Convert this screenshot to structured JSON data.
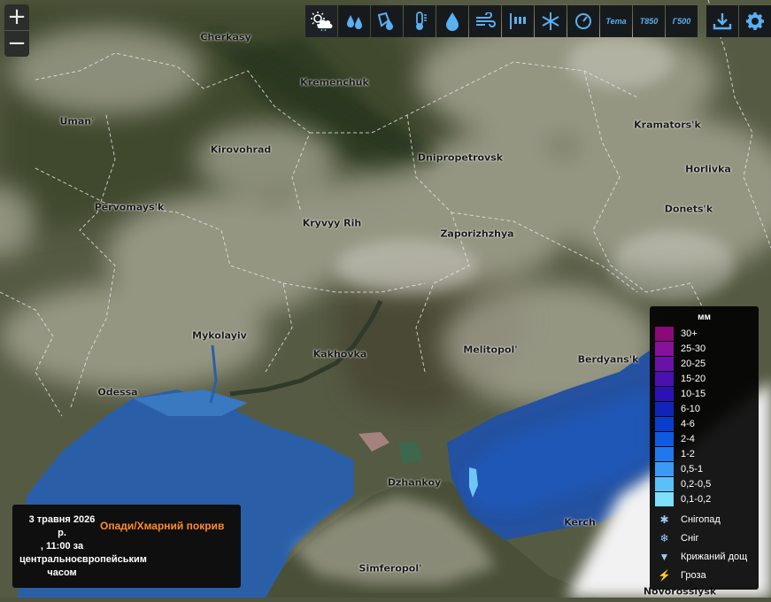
{
  "toolbar": {
    "icons": [
      "weather-icon",
      "precip-drops-icon",
      "precip-type-icon",
      "thermometer-icon",
      "humidity-drop-icon",
      "wind-icon",
      "wind-gust-icon",
      "snow-icon",
      "pressure-gauge-icon"
    ],
    "theta_label": "Тета",
    "t850_label": "T850",
    "g500_label": "Г500",
    "download_icon": "download-icon",
    "settings_icon": "gear-icon"
  },
  "zoom": {
    "in": "+",
    "out": "−"
  },
  "cities": [
    {
      "name": "Cherkasy"
    },
    {
      "name": "Kremenchuk"
    },
    {
      "name": "Uman'"
    },
    {
      "name": "Kirovohrad"
    },
    {
      "name": "Dnipropetrovsk"
    },
    {
      "name": "Kramators'k"
    },
    {
      "name": "Horlivka"
    },
    {
      "name": "Pervomays'k"
    },
    {
      "name": "Kryvyy Rih"
    },
    {
      "name": "Zaporizhzhya"
    },
    {
      "name": "Donets'k"
    },
    {
      "name": "Mykolayiv"
    },
    {
      "name": "Kakhovka"
    },
    {
      "name": "Melitopol'"
    },
    {
      "name": "Berdyans'k"
    },
    {
      "name": "Odessa"
    },
    {
      "name": "Dzhankoy"
    },
    {
      "name": "Kerch"
    },
    {
      "name": "Simferopol'"
    },
    {
      "name": "Novorossiysk"
    }
  ],
  "legend": {
    "unit": "мм",
    "items": [
      {
        "label": "30+",
        "color": "#8a0a78"
      },
      {
        "label": "25-30",
        "color": "#86119a"
      },
      {
        "label": "20-25",
        "color": "#6a12a8"
      },
      {
        "label": "15-20",
        "color": "#4a10b0"
      },
      {
        "label": "10-15",
        "color": "#2c12b4"
      },
      {
        "label": "6-10",
        "color": "#1024b8"
      },
      {
        "label": "4-6",
        "color": "#0a3cd0"
      },
      {
        "label": "2-4",
        "color": "#0f5ae0"
      },
      {
        "label": "1-2",
        "color": "#1f78f0"
      },
      {
        "label": "0,5-1",
        "color": "#3a9af5"
      },
      {
        "label": "0,2-0,5",
        "color": "#5cc0f8"
      },
      {
        "label": "0,1-0,2",
        "color": "#7fe0fb"
      }
    ],
    "types": [
      {
        "label": "Снігопад",
        "icon": "snowflake-icon",
        "glyph": "✱"
      },
      {
        "label": "Сніг",
        "icon": "snow-flakes-icon",
        "glyph": "❄"
      },
      {
        "label": "Крижаний дощ",
        "icon": "freezing-rain-icon",
        "glyph": "▼"
      },
      {
        "label": "Гроза",
        "icon": "lightning-icon",
        "glyph": "⚡"
      }
    ]
  },
  "info": {
    "date_line1": "3 травня 2026",
    "date_line2": "р.",
    "date_line3": ", 11:00 за",
    "date_line4": "центральноєвропейським",
    "date_line5": "часом",
    "layer": "Опади/Хмарний покрив"
  }
}
